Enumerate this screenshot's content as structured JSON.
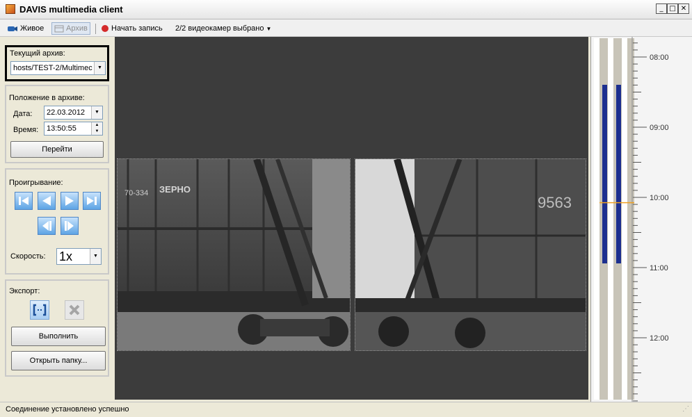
{
  "window": {
    "title": "DAVIS multimedia client"
  },
  "toolbar": {
    "live_label": "Живое",
    "archive_label": "Архив",
    "record_label": "Начать запись",
    "cameras_label": "2/2 видеокамер выбрано"
  },
  "archive": {
    "label": "Текущий архив:",
    "value": "hosts/TEST-2/Multimec"
  },
  "position": {
    "label": "Положение в архиве:",
    "date_label": "Дата:",
    "date_value": "22.03.2012",
    "time_label": "Время:",
    "time_value": "13:50:55",
    "go_label": "Перейти"
  },
  "playback": {
    "label": "Проигрывание:",
    "speed_label": "Скорость:",
    "speed_value": "1x"
  },
  "export": {
    "label": "Экспорт:",
    "execute_label": "Выполнить",
    "open_folder_label": "Открыть папку..."
  },
  "timeline": {
    "ticks": [
      "08:00",
      "09:00",
      "10:00",
      "11:00",
      "12:00"
    ],
    "current_time_fraction": 0.66
  },
  "cameras": [
    {
      "car_text": "ЗЕРНО",
      "plate": "70-334"
    },
    {
      "car_text": "9563"
    }
  ],
  "status": {
    "text": "Соединение установлено успешно"
  },
  "colors": {
    "accent": "#1c2f8f",
    "tick_marker": "#f0a020",
    "video_bg": "#3c3c3c"
  }
}
